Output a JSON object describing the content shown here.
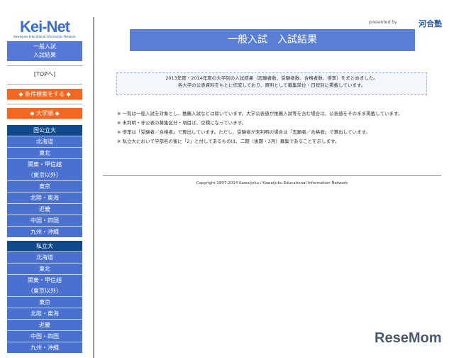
{
  "logo": {
    "text_a": "Kei",
    "text_b": "-Net",
    "subtitle": "Kawaijuku Educational Information Network"
  },
  "sidebar": {
    "current_line1": "一般入試",
    "current_line2": "入試結果",
    "top_link": "[TOPへ]",
    "search_button": "◆ 条件検索をする ◆",
    "university_button": "◆ 大学順 ◆",
    "national": {
      "header": "国公立大",
      "items": [
        "北海道",
        "東北",
        "関東・甲信越",
        "（東京以外）",
        "東京",
        "北陸・東海",
        "近畿",
        "中国・四国",
        "九州・沖縄"
      ]
    },
    "private": {
      "header": "私立大",
      "items": [
        "北海道",
        "東北",
        "関東・甲信越",
        "（東京以外）",
        "東京",
        "北陸・東海",
        "近畿",
        "中国・四国",
        "九州・沖縄"
      ]
    }
  },
  "header": {
    "presented_by": "presented by",
    "brand": "河合塾",
    "title": "一般入試　入試結果"
  },
  "info": {
    "line1": "2013年度・2014年度の大学別の入試結果（志願者数、受験者数、合格者数、倍率）をまとめました。",
    "line2": "各大学の公表資料をもとに作成しており、原則として募集単位・日程別に掲載しています。"
  },
  "notes": [
    "※ 一覧は一般入試を対象とし、推薦入試などは除いています。大学公表値が推薦入試等を含む場合は、公表値をそのまま掲載しています。",
    "※ 未判明・非公表の募集区分・項目は、空欄になっています。",
    "※ 倍率は「受験者／合格者」で算出しています。ただし、受験者が未判明の場合は「志願者／合格者」で算出しています。",
    "※ 私立大において学部名の後に「2」と付してあるものは、二期（後期・3月）募集であることを示します。"
  ],
  "footer": {
    "copyright": "Copyright 1997-2014 Kawaijuku / Kawaijuku Educational Information Network"
  },
  "watermark": "ReseMom"
}
